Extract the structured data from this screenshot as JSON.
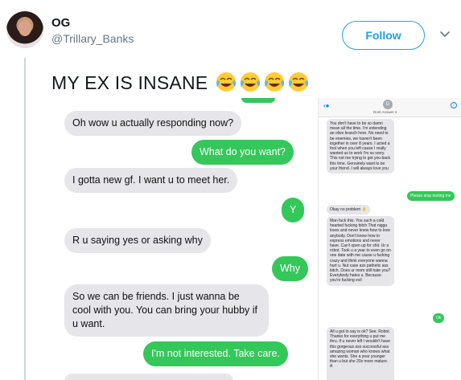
{
  "tweet": {
    "display_name": "OG",
    "handle": "@Trillary_Banks",
    "follow_label": "Follow",
    "text": "MY EX IS INSANE",
    "emoji_icon": "face-with-tears-of-joy-icon"
  },
  "left_conversation": {
    "messages": [
      {
        "from": "them",
        "text": "Oh wow u actually responding now?"
      },
      {
        "from": "me",
        "text": "What do you want?"
      },
      {
        "from": "them",
        "text": "I gotta new gf. I want u to meet her."
      },
      {
        "from": "me",
        "text": "Y"
      },
      {
        "from": "them",
        "text": "R u saying yes or asking why"
      },
      {
        "from": "me",
        "text": "Why"
      },
      {
        "from": "them",
        "text": "So we can be friends. I just wanna be cool with you. You can bring your hubby if u want."
      },
      {
        "from": "me",
        "text": "I'm not interested. Take care."
      }
    ]
  },
  "right_conversation": {
    "contact_name": "Dont Answer 4",
    "contact_initial": "D",
    "messages": [
      {
        "from": "them",
        "text": "You don't have to be so damn mean all the time. I'm extending an olive branch here. No need to be enemies, we haven't been together in over 8 years. I acted a fool when you left cause I really wanted us to work I'm so sorry. This not me trying to get you back this time. Genuinely want to be your friend. I will always love you"
      },
      {
        "from": "me",
        "text": "Please stop texting me"
      },
      {
        "from": "them",
        "text": "Okay no problem 👌"
      },
      {
        "from": "them",
        "text": "Man fuck this. You such a cold hearted fucking bitch That nigga loves and never knew how to love anybody. Don't know how to express emotions and never have. Can't open up for shit. Ur a robot. Took u a year to even go on one date with me cause u fucking crazy and think everyone wanna hurt u. Nut case ass pathetic ass bitch. Does ur mom still hate you? Everybody hates u. Because you're fucking evil"
      },
      {
        "from": "me",
        "text": "Ok"
      },
      {
        "from": "them",
        "text": "All u got to say is ok? See. Robot. Thanks for everything u put me thru. If u never left I wouldn't have this gorgeous ass successful ass amazing woman who knows what she wants. She a year younger than u but she 20x more mature. A"
      }
    ]
  },
  "colors": {
    "twitter_blue": "#1da1f2",
    "imessage_green": "#34c759",
    "incoming_gray": "#e5e5ea"
  }
}
